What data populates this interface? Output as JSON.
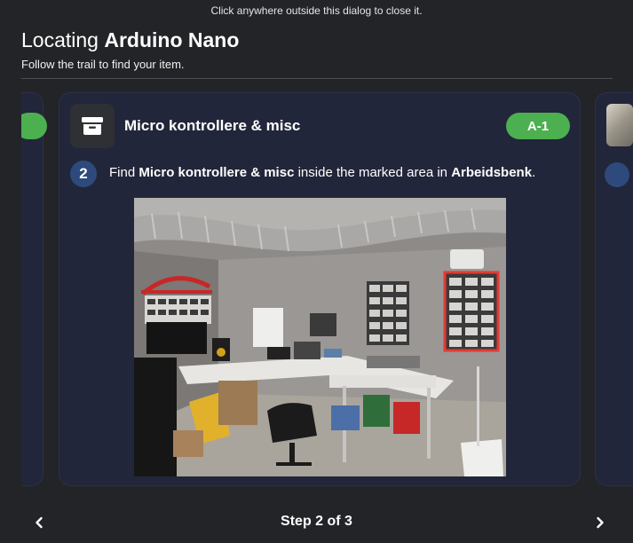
{
  "dialog": {
    "close_hint": "Click anywhere outside this dialog to close it.",
    "title_prefix": "Locating",
    "title_item": "Arduino Nano",
    "subtitle": "Follow the trail to find your item."
  },
  "current_step": {
    "container_name": "Micro kontrollere & misc",
    "location_badge": "A-1",
    "step_number": "2",
    "instruction": {
      "prefix": "Find",
      "container": "Micro kontrollere & misc",
      "middle": "inside the marked area in",
      "area": "Arbeidsbenk",
      "suffix": "."
    },
    "icons": {
      "container": "archive-box-icon"
    }
  },
  "navigation": {
    "step_label": "Step 2 of 3",
    "prev_icon": "chevron-left-icon",
    "next_icon": "chevron-right-icon"
  },
  "colors": {
    "background": "#232428",
    "card": "#22263a",
    "badge_green": "#4caf50",
    "step_circle": "#2e4a7c",
    "marked_area": "#e53935"
  }
}
